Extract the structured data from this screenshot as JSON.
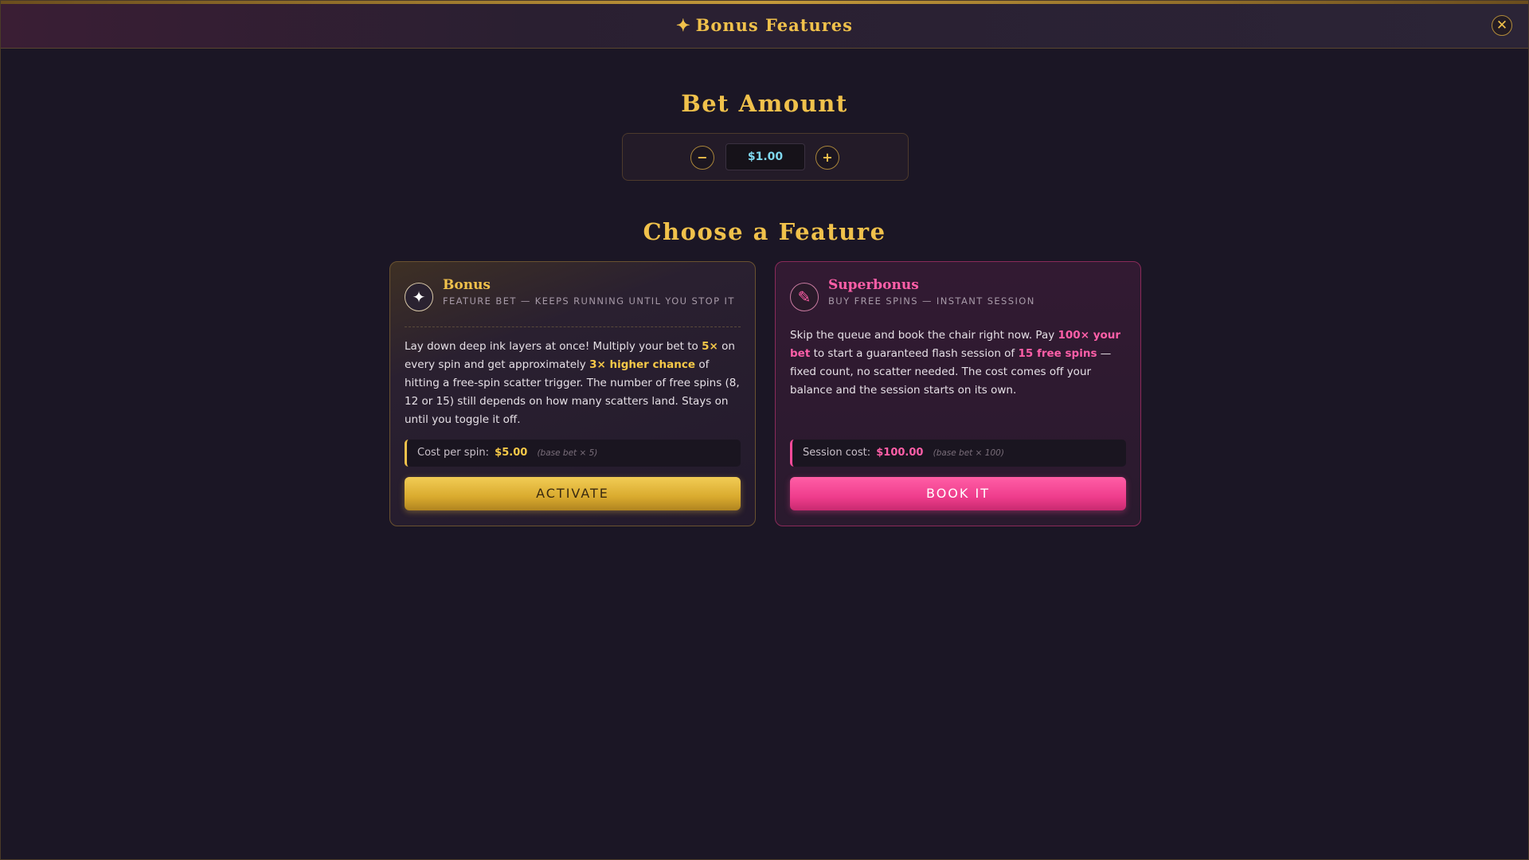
{
  "header": {
    "star_icon": "✦",
    "title": "Bonus Features",
    "close_icon": "✕"
  },
  "bet": {
    "heading": "Bet Amount",
    "minus_label": "−",
    "plus_label": "+",
    "value": "$1.00"
  },
  "features_heading": "Choose a Feature",
  "bonus_card": {
    "icon": "✦",
    "name": "Bonus",
    "subtitle": "FEATURE BET — KEEPS RUNNING UNTIL YOU STOP IT",
    "desc_1": "Lay down deep ink layers at once! Multiply your bet to ",
    "desc_hl_1": "5×",
    "desc_2": " on every spin and get approximately ",
    "desc_hl_2": "3× higher chance",
    "desc_3": " of hitting a free-spin scatter trigger. The number of free spins (8, 12 or 15) still depends on how many scatters land. Stays on until you toggle it off.",
    "cost_label": "Cost per spin:",
    "cost_value": "$5.00",
    "cost_note": "(base bet × 5)",
    "button_label": "ACTIVATE"
  },
  "super_card": {
    "icon": "✎",
    "name": "Superbonus",
    "subtitle": "BUY FREE SPINS — INSTANT SESSION",
    "desc_1": "Skip the queue and book the chair right now. Pay ",
    "desc_hl_1": "100× your bet",
    "desc_2": " to start a guaranteed flash session of ",
    "desc_hl_2": "15 free spins",
    "desc_3": " — fixed count, no scatter needed. The cost comes off your balance and the session starts on its own.",
    "cost_label": "Session cost:",
    "cost_value": "$100.00",
    "cost_note": "(base bet × 100)",
    "button_label": "BOOK IT"
  },
  "colors": {
    "gold_accent": "#f0c14b",
    "pink_accent": "#ff5fa8",
    "bet_value": "#7fd8ef",
    "background": "#1b1625"
  }
}
